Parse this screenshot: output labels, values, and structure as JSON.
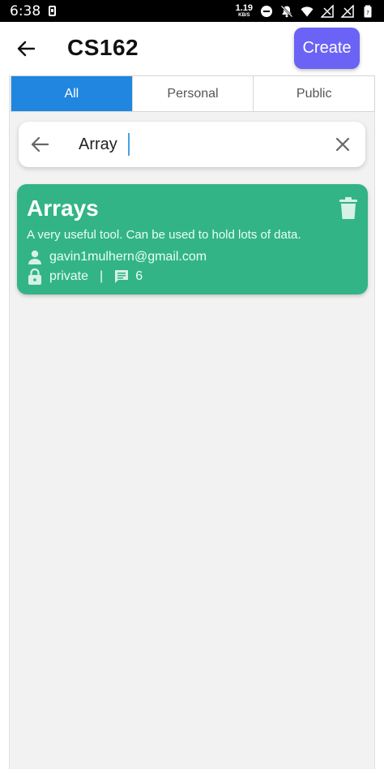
{
  "status_bar": {
    "time": "6:38",
    "net_speed_value": "1.19",
    "net_speed_unit": "KB/S",
    "icons": [
      "sim-icon",
      "dnd-icon",
      "notifications-off-icon",
      "wifi-icon",
      "signal-icon",
      "signal-icon",
      "battery-icon"
    ]
  },
  "header": {
    "title": "CS162",
    "create_label": "Create",
    "accent_color": "#6b63f5"
  },
  "tabs": [
    {
      "label": "All",
      "active": true
    },
    {
      "label": "Personal",
      "active": false
    },
    {
      "label": "Public",
      "active": false
    }
  ],
  "search": {
    "value": "Array"
  },
  "results": [
    {
      "title": "Arrays",
      "description": "A very useful tool. Can be used to hold lots of data.",
      "owner": "gavin1mulhern@gmail.com",
      "visibility": "private",
      "comment_count": "6",
      "card_color": "#33b486"
    }
  ],
  "colors": {
    "tab_active": "#2086e0"
  }
}
